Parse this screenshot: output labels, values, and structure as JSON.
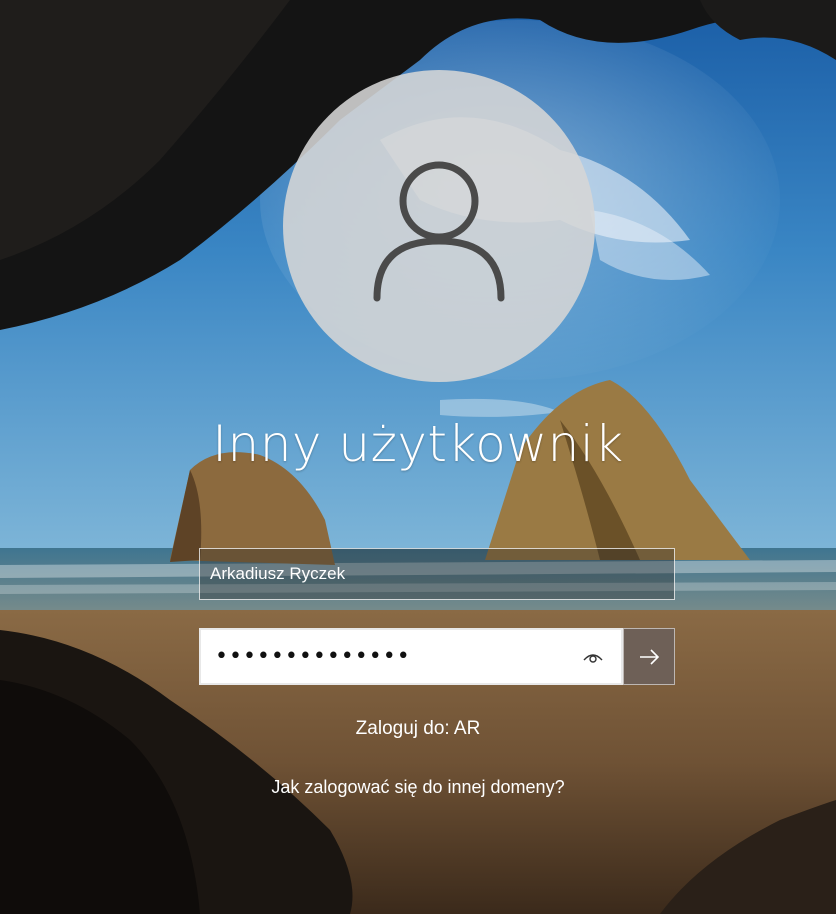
{
  "login": {
    "title": "Inny użytkownik",
    "username_value": "Arkadiusz Ryczek",
    "password_mask": "••••••••••••••",
    "sign_in_to": "Zaloguj do: AR",
    "other_domain_link": "Jak zalogować się do innej domeny?"
  },
  "icons": {
    "avatar": "user-avatar-icon",
    "reveal": "eye-icon",
    "submit": "arrow-right-icon"
  },
  "colors": {
    "avatar_bg": "#d6d6d6",
    "avatar_fg": "#4a4a4a",
    "submit_bg": "#6e6057",
    "text": "#ffffff"
  }
}
